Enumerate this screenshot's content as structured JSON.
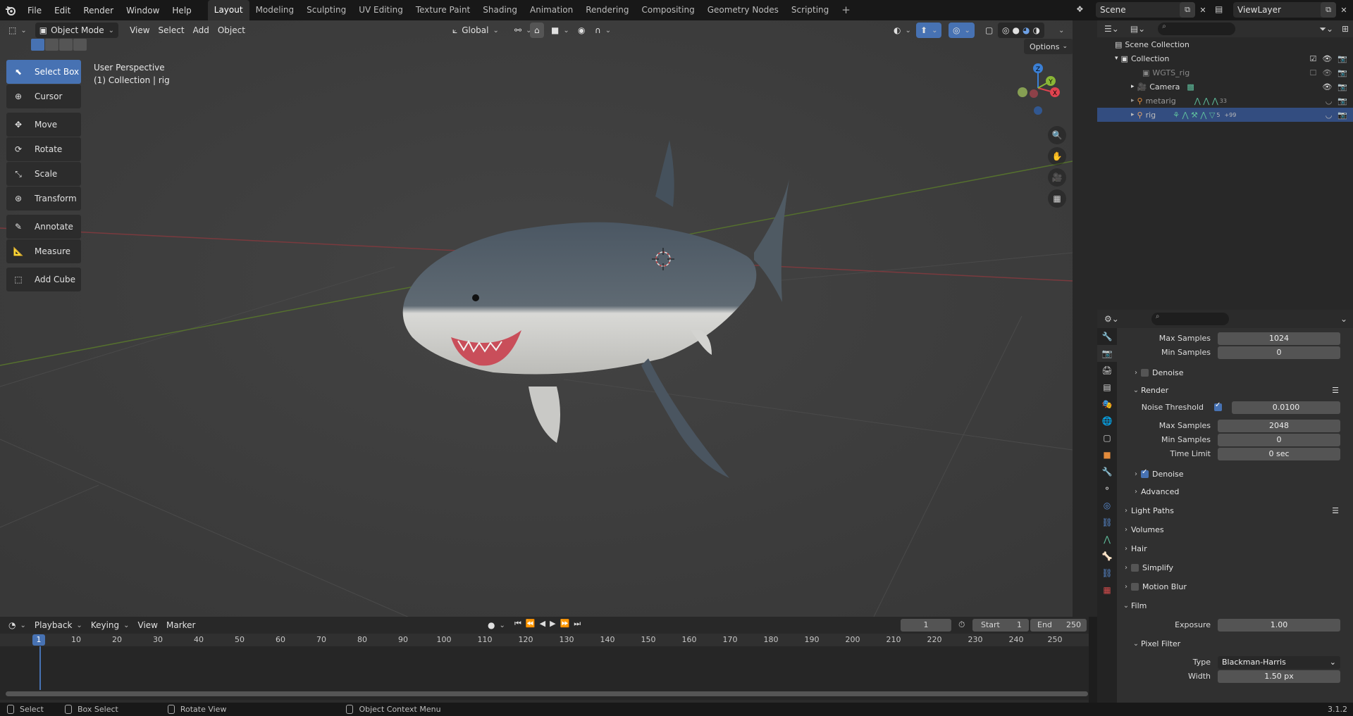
{
  "menu": [
    "File",
    "Edit",
    "Render",
    "Window",
    "Help"
  ],
  "workspaces": [
    "Layout",
    "Modeling",
    "Sculpting",
    "UV Editing",
    "Texture Paint",
    "Shading",
    "Animation",
    "Rendering",
    "Compositing",
    "Geometry Nodes",
    "Scripting"
  ],
  "workspace_add": "+",
  "scene": "Scene",
  "view_layer": "ViewLayer",
  "viewport": {
    "mode": "Object Mode",
    "menus": [
      "View",
      "Select",
      "Add",
      "Object"
    ],
    "transform_orientation": "Global",
    "view_name": "User Perspective",
    "collection_info": "(1) Collection | rig",
    "options": "Options",
    "gizmo": {
      "z": "Z",
      "y": "Y",
      "x": "X"
    }
  },
  "tools": [
    "Select Box",
    "Cursor",
    "Move",
    "Rotate",
    "Scale",
    "Transform",
    "Annotate",
    "Measure",
    "Add Cube"
  ],
  "outliner": {
    "root": "Scene Collection",
    "collection": "Collection",
    "items": [
      {
        "name": "WGTS_rig",
        "badge": ""
      },
      {
        "name": "Camera",
        "badge": ""
      },
      {
        "name": "metarig",
        "badge": "33"
      },
      {
        "name": "rig",
        "badge": "5",
        "badge2": "+99"
      }
    ]
  },
  "properties": {
    "max_samples_label": "Max Samples",
    "max_samples_viewport": "1024",
    "min_samples_label": "Min Samples",
    "min_samples_viewport": "0",
    "denoise": "Denoise",
    "render": "Render",
    "noise_threshold_label": "Noise Threshold",
    "noise_threshold": "0.0100",
    "max_samples_render": "2048",
    "min_samples_render": "0",
    "time_limit_label": "Time Limit",
    "time_limit": "0 sec",
    "denoise2": "Denoise",
    "advanced": "Advanced",
    "light_paths": "Light Paths",
    "volumes": "Volumes",
    "hair": "Hair",
    "simplify": "Simplify",
    "motion_blur": "Motion Blur",
    "film": "Film",
    "exposure_label": "Exposure",
    "exposure": "1.00",
    "pixel_filter": "Pixel Filter",
    "type_label": "Type",
    "type": "Blackman-Harris",
    "width_label": "Width",
    "width": "1.50 px"
  },
  "timeline": {
    "menus": [
      "Playback",
      "Keying",
      "View",
      "Marker"
    ],
    "current_frame": "1",
    "start_label": "Start",
    "start": "1",
    "end_label": "End",
    "end": "250",
    "ticks": [
      "1",
      "10",
      "20",
      "30",
      "40",
      "50",
      "60",
      "70",
      "80",
      "90",
      "100",
      "110",
      "120",
      "130",
      "140",
      "150",
      "160",
      "170",
      "180",
      "190",
      "200",
      "210",
      "220",
      "230",
      "240",
      "250"
    ]
  },
  "status": {
    "select": "Select",
    "box_select": "Box Select",
    "rotate_view": "Rotate View",
    "context_menu": "Object Context Menu",
    "version": "3.1.2"
  },
  "colors": {
    "accent": "#4772b3",
    "viewport_bg": "#3d3d3d",
    "x_axis": "#e0434f",
    "y_axis": "#8ab636",
    "z_axis": "#3b80d6"
  }
}
